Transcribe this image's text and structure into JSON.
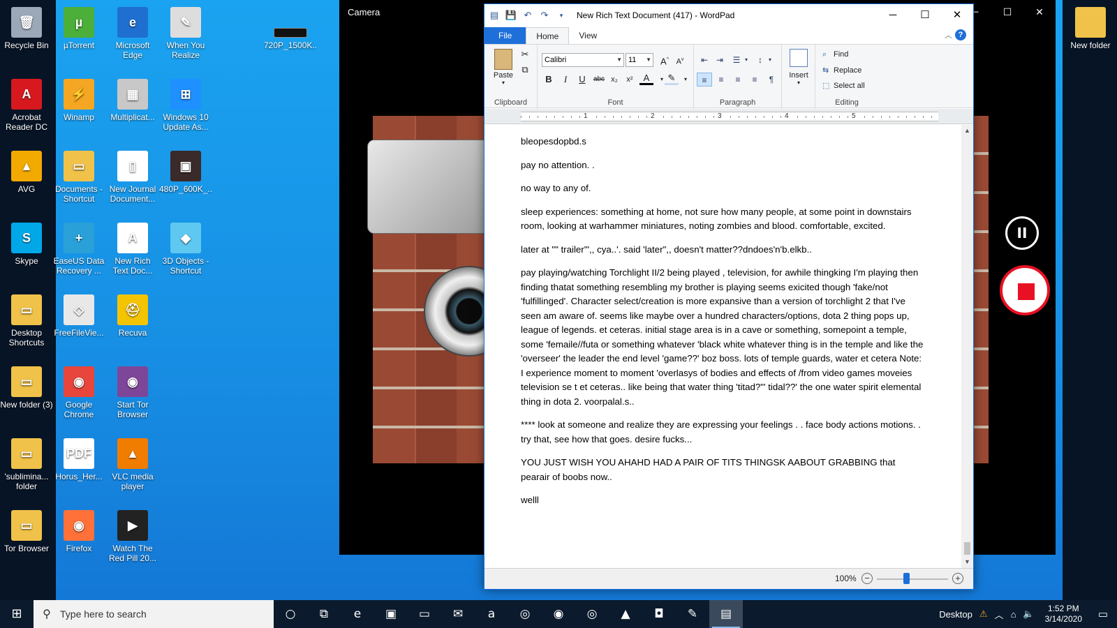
{
  "desktop": {
    "icons_col1": [
      {
        "label": "Recycle Bin",
        "icon": "recycle-bin-icon",
        "color": "#9aa8b8",
        "glyph": "🗑"
      },
      {
        "label": "Acrobat Reader DC",
        "icon": "acrobat-icon",
        "color": "#d7191f",
        "glyph": "A"
      },
      {
        "label": "AVG",
        "icon": "avg-icon",
        "color": "#f2a900",
        "glyph": "▲"
      },
      {
        "label": "Skype",
        "icon": "skype-icon",
        "color": "#00a8e8",
        "glyph": "S"
      },
      {
        "label": "Desktop Shortcuts",
        "icon": "folder-icon",
        "color": "#f0c24a",
        "glyph": "▭"
      },
      {
        "label": "New folder (3)",
        "icon": "folder-icon",
        "color": "#f0c24a",
        "glyph": "▭"
      },
      {
        "label": "'sublimina... folder",
        "icon": "folder-icon",
        "color": "#f0c24a",
        "glyph": "▭"
      },
      {
        "label": "Tor Browser",
        "icon": "tor-folder-icon",
        "color": "#f0c24a",
        "glyph": "▭"
      }
    ],
    "icons_col2": [
      {
        "label": "µTorrent",
        "icon": "utorrent-icon",
        "color": "#4caf3a",
        "glyph": "µ"
      },
      {
        "label": "Winamp",
        "icon": "winamp-icon",
        "color": "#f5a623",
        "glyph": "⚡"
      },
      {
        "label": "Documents - Shortcut",
        "icon": "documents-folder-icon",
        "color": "#f0c24a",
        "glyph": "▭"
      },
      {
        "label": "EaseUS Data Recovery ...",
        "icon": "easeus-icon",
        "color": "#2aa0d8",
        "glyph": "+"
      },
      {
        "label": "FreeFileVie...",
        "icon": "freefileviewer-icon",
        "color": "#e8e8e8",
        "glyph": "◇"
      },
      {
        "label": "Google Chrome",
        "icon": "chrome-icon",
        "color": "#e8453c",
        "glyph": "◉"
      },
      {
        "label": "Horus_Her...",
        "icon": "pdf-icon",
        "color": "#ffffff",
        "glyph": "PDF"
      },
      {
        "label": "Firefox",
        "icon": "firefox-icon",
        "color": "#ff7139",
        "glyph": "◉"
      }
    ],
    "icons_col3": [
      {
        "label": "Microsoft Edge",
        "icon": "edge-icon",
        "color": "#1f6fd1",
        "glyph": "e"
      },
      {
        "label": "Multiplicat...",
        "icon": "image-file-icon",
        "color": "#c8c8c8",
        "glyph": "▦"
      },
      {
        "label": "New Journal Document...",
        "icon": "journal-file-icon",
        "color": "#ffffff",
        "glyph": "▯"
      },
      {
        "label": "New Rich Text Doc...",
        "icon": "rtf-file-icon",
        "color": "#ffffff",
        "glyph": "A"
      },
      {
        "label": "Recuva",
        "icon": "recuva-icon",
        "color": "#f5c400",
        "glyph": "⛑"
      },
      {
        "label": "Start Tor Browser",
        "icon": "tor-icon",
        "color": "#7d4698",
        "glyph": "◉"
      },
      {
        "label": "VLC media player",
        "icon": "vlc-icon",
        "color": "#f07c00",
        "glyph": "▲"
      },
      {
        "label": "Watch The Red Pill 20...",
        "icon": "video-icon",
        "color": "#222222",
        "glyph": "▶"
      }
    ],
    "icons_col4": [
      {
        "label": "When You Realize",
        "icon": "gradient-image-icon",
        "color": "#dddddd",
        "glyph": "✎"
      },
      {
        "label": "Windows 10 Update As...",
        "icon": "windows-update-icon",
        "color": "#1e90ff",
        "glyph": "⊞"
      },
      {
        "label": "480P_600K_...",
        "icon": "video-file-icon",
        "color": "#3a2a2a",
        "glyph": "▣"
      },
      {
        "label": "3D Objects - Shortcut",
        "icon": "3d-objects-icon",
        "color": "#5ec8f0",
        "glyph": "◆"
      }
    ],
    "extra_icon": {
      "label": "720P_1500K...",
      "icon": "video-file-icon"
    },
    "right_icon": {
      "label": "New folder",
      "icon": "folder-icon"
    }
  },
  "camera": {
    "title": "Camera",
    "pause_glyph": "II"
  },
  "wordpad": {
    "title": "New Rich Text Document (417) - WordPad",
    "tabs": [
      "File",
      "Home",
      "View"
    ],
    "clipboard": {
      "paste": "Paste",
      "label": "Clipboard"
    },
    "font": {
      "family": "Calibri",
      "size": "11",
      "label": "Font"
    },
    "paragraph": {
      "label": "Paragraph"
    },
    "insert": {
      "label": "Insert"
    },
    "editing": {
      "find": "Find",
      "replace": "Replace",
      "select_all": "Select all",
      "label": "Editing"
    },
    "ruler_numbers": [
      "1",
      "2",
      "3",
      "4",
      "5"
    ],
    "paragraphs": [
      "bleopesdopbd.s",
      "pay no attention. .",
      "no way to any of.",
      "sleep experiences: something at home, not sure how many people, at some point in downstairs room, looking at warhammer miniatures, noting zombies and blood. comfortable, excited.",
      "later at \"\" trailer'\",, cya..'. said 'later\",, doesn't matter??dndoes'n'b.elkb..",
      "pay playing/watching Torchlight II/2 being played , television, for awhile thingking I'm playing then finding thatat something resembling my brother is playing seems exicited though 'fake/not 'fulfillinged'. Character select/creation is more expansive than a version of torchlight 2 that I've seen am aware of. seems like maybe over a hundred characters/options, dota 2 thing pops up, league of legends. et ceteras. initial stage area is in a cave or something, somepoint a temple, some 'femaile//futa or something whatever 'black white whatever thing is in the temple and like the 'overseer' the leader the end level 'game??' boz boss. lots of temple guards, water et cetera Note: I experience moment to moment 'overlasys of bodies and effects of /from video games moveies television se t et ceteras.. like being that water thing 'titad?\"' tidal??' the one water spirit elemental thing in dota 2. voorpalal.s..",
      "**** look at someone and realize they are expressing your feelings . . face body actions motions. . try that, see how that goes. desire fucks...",
      "YOU JUST WISH YOU AHAHD  HAD A PAIR OF TITS THINGSK AABOUT GRABBING that pearair of boobs now..",
      "welll"
    ],
    "zoom": "100%",
    "zoom_level": 0.42
  },
  "taskbar": {
    "search_placeholder": "Type here to search",
    "desktop_label": "Desktop",
    "time": "1:52 PM",
    "date": "3/14/2020",
    "apps": [
      {
        "icon": "cortana-icon",
        "glyph": "○"
      },
      {
        "icon": "task-view-icon",
        "glyph": "⧉"
      },
      {
        "icon": "edge-icon",
        "glyph": "e"
      },
      {
        "icon": "store-icon",
        "glyph": "▣"
      },
      {
        "icon": "file-explorer-icon",
        "glyph": "▭"
      },
      {
        "icon": "mail-icon",
        "glyph": "✉"
      },
      {
        "icon": "amazon-icon",
        "glyph": "a"
      },
      {
        "icon": "tripadvisor-icon",
        "glyph": "◎"
      },
      {
        "icon": "app-icon",
        "glyph": "◉"
      },
      {
        "icon": "color-app-icon",
        "glyph": "◎"
      },
      {
        "icon": "vlc-icon",
        "glyph": "▲"
      },
      {
        "icon": "camera-icon",
        "glyph": "◘"
      },
      {
        "icon": "paint-icon",
        "glyph": "✎"
      },
      {
        "icon": "wordpad-icon",
        "glyph": "▤"
      }
    ]
  },
  "colors": {
    "accent": "#1e6fd9",
    "record_red": "#e81123"
  }
}
